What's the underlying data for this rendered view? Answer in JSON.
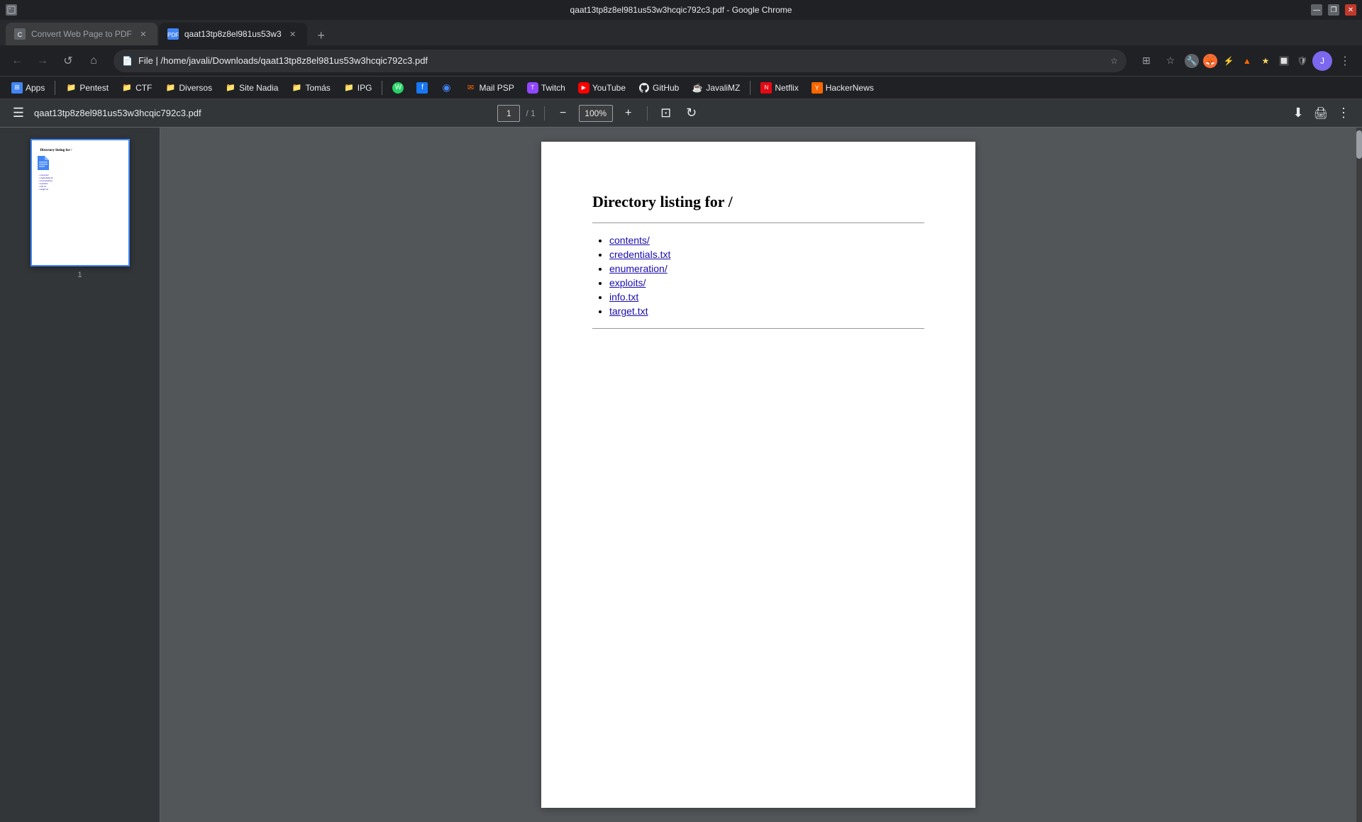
{
  "window": {
    "title": "qaat13tp8z8el981us53w3hcqic792c3.pdf - Google Chrome",
    "minimize": "—",
    "restore": "❐",
    "close": "✕"
  },
  "tabs": [
    {
      "id": "tab1",
      "label": "Convert Web Page to PDF",
      "icon": "convert-icon",
      "active": false
    },
    {
      "id": "tab2",
      "label": "qaat13tp8z8el981us53w3",
      "icon": "pdf-icon",
      "active": true
    }
  ],
  "new_tab_label": "+",
  "nav": {
    "back": "←",
    "forward": "→",
    "reload": "↺",
    "home": "⌂",
    "address": "File | /home/javali/Downloads/qaat13tp8z8el981us53w3hcqic792c3.pdf",
    "extensions": "⊞",
    "bookmark": "☆",
    "profile": "👤"
  },
  "bookmarks": [
    {
      "id": "apps",
      "label": "Apps",
      "icon_text": "⊞",
      "icon_class": "bm-apps"
    },
    {
      "id": "pentest",
      "label": "Pentest",
      "icon_class": "bm-pentest",
      "icon_text": "📁"
    },
    {
      "id": "ctf",
      "label": "CTF",
      "icon_class": "bm-ctf",
      "icon_text": "📁"
    },
    {
      "id": "diversos",
      "label": "Diversos",
      "icon_class": "bm-diversos",
      "icon_text": "📁"
    },
    {
      "id": "sitenadia",
      "label": "Site Nadia",
      "icon_class": "bm-sitenadia",
      "icon_text": "📁"
    },
    {
      "id": "tomas",
      "label": "Tomás",
      "icon_class": "bm-tomas",
      "icon_text": "📁"
    },
    {
      "id": "ipg",
      "label": "IPG",
      "icon_class": "bm-ipg",
      "icon_text": "📁"
    },
    {
      "id": "whatsapp",
      "label": "",
      "icon_text": "W",
      "icon_class": "bm-wa"
    },
    {
      "id": "facebook",
      "label": "",
      "icon_text": "f",
      "icon_class": "bm-fb"
    },
    {
      "id": "chrome",
      "label": "",
      "icon_text": "◉",
      "icon_class": "bm-chrome"
    },
    {
      "id": "mailpsp",
      "label": "Mail PSP",
      "icon_class": "bm-mailpsp",
      "icon_text": "✉"
    },
    {
      "id": "twitch",
      "label": "Twitch",
      "icon_text": "T",
      "icon_class": "bm-twitch"
    },
    {
      "id": "youtube",
      "label": "YouTube",
      "icon_text": "▶",
      "icon_class": "bm-youtube"
    },
    {
      "id": "github",
      "label": "GitHub",
      "icon_text": "⚙",
      "icon_class": "bm-github"
    },
    {
      "id": "javalmz",
      "label": "JavaliMZ",
      "icon_class": "bm-javalmz",
      "icon_text": "J"
    },
    {
      "id": "netflix",
      "label": "Netflix",
      "icon_text": "N",
      "icon_class": "bm-netflix"
    },
    {
      "id": "hackernews",
      "label": "HackerNews",
      "icon_text": "Y",
      "icon_class": "bm-hackernews"
    }
  ],
  "pdf_toolbar": {
    "menu_icon": "☰",
    "filename": "qaat13tp8z8el981us53w3hcqic792c3.pdf",
    "page_current": "1",
    "page_sep": "/ 1",
    "zoom_out": "−",
    "zoom_in": "+",
    "zoom_value": "100%",
    "fit_page": "⊡",
    "rotate": "↻",
    "download": "⬇",
    "print": "🖨",
    "more": "⋮"
  },
  "pdf_content": {
    "title": "Directory listing for /",
    "links": [
      {
        "id": "link1",
        "text": "contents/"
      },
      {
        "id": "link2",
        "text": "credentials.txt"
      },
      {
        "id": "link3",
        "text": "enumeration/"
      },
      {
        "id": "link4",
        "text": "exploits/"
      },
      {
        "id": "link5",
        "text": "info.txt"
      },
      {
        "id": "link6",
        "text": "target.txt"
      }
    ]
  },
  "pdf_sidebar": {
    "page_number": "1",
    "thumbnail_title": "Directory listing for /"
  }
}
